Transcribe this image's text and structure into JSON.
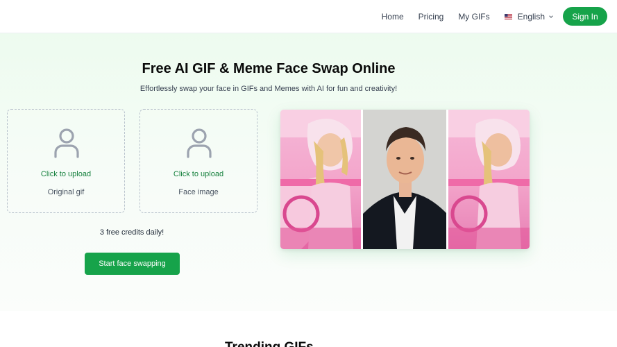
{
  "nav": {
    "home": "Home",
    "pricing": "Pricing",
    "my_gifs": "My GIFs",
    "language": "English",
    "language_flag": "us-flag-icon",
    "sign_in": "Sign In"
  },
  "hero": {
    "title": "Free AI GIF & Meme Face Swap Online",
    "subtitle": "Effortlessly swap your face in GIFs and Memes with AI for fun and creativity!"
  },
  "upload": {
    "original": {
      "cta": "Click to upload",
      "label": "Original gif",
      "icon": "user-icon"
    },
    "face": {
      "cta": "Click to upload",
      "label": "Face image",
      "icon": "user-icon"
    }
  },
  "credits_text": "3 free credits daily!",
  "start_button": "Start face swapping",
  "preview": {
    "panels": [
      "original-gif-frame",
      "face-photo",
      "swapped-gif-frame"
    ]
  },
  "trending_title": "Trending GIFs",
  "colors": {
    "accent": "#16a34a",
    "accent_text": "#15803d",
    "hero_bg": "#edfbef"
  }
}
